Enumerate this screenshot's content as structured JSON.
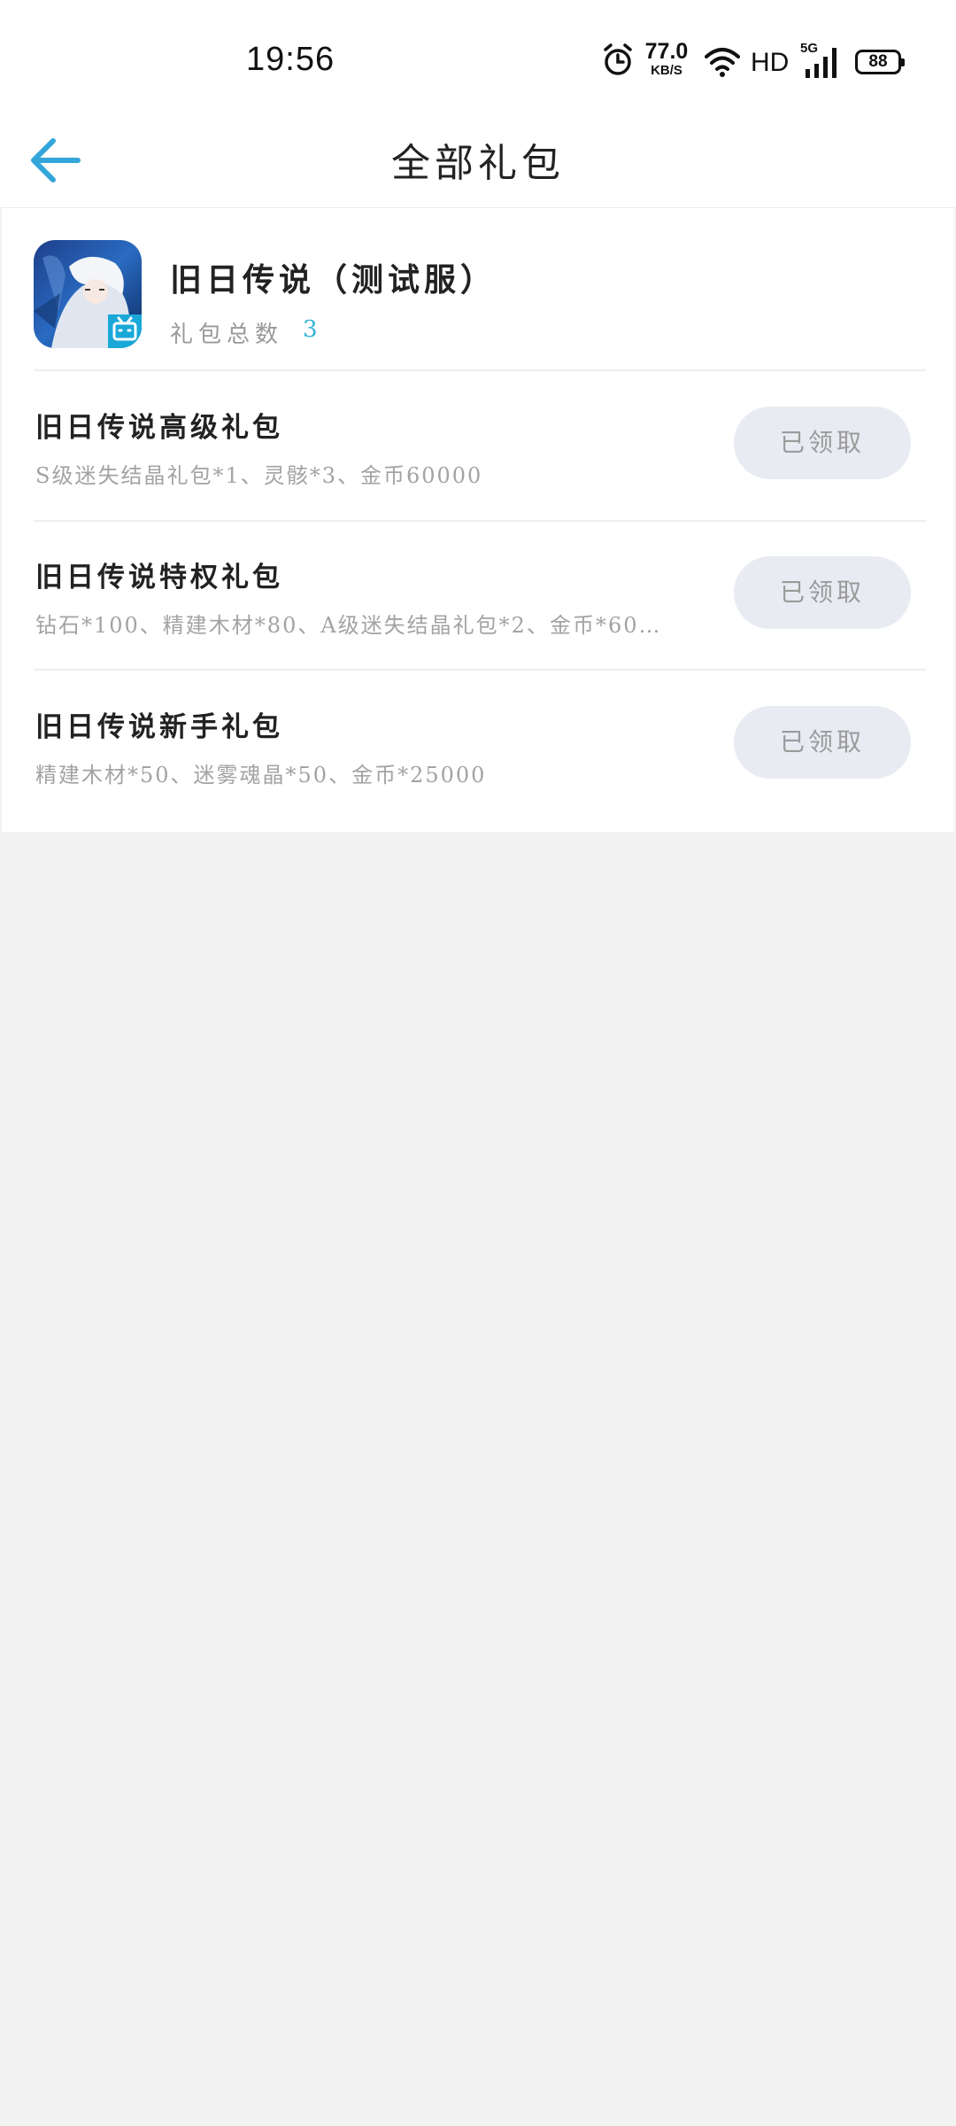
{
  "status_bar": {
    "time": "19:56",
    "net_speed_value": "77.0",
    "net_speed_unit": "KB/S",
    "network_label": "HD",
    "signal_label": "5G",
    "battery": "88",
    "icons": [
      "alarm-icon",
      "wifi-icon",
      "signal-icon",
      "battery-icon"
    ]
  },
  "header": {
    "title": "全部礼包",
    "back_icon": "arrow-left-icon",
    "accent_color": "#33a6d9"
  },
  "game": {
    "name": "旧日传说（测试服）",
    "gift_total_label": "礼包总数",
    "gift_total_count": "3",
    "count_color": "#33b4d6"
  },
  "gifts": [
    {
      "title": "旧日传说高级礼包",
      "desc": "S级迷失结晶礼包*1、灵骸*3、金币60000",
      "button": "已领取"
    },
    {
      "title": "旧日传说特权礼包",
      "desc": "钻石*100、精建木材*80、A级迷失结晶礼包*2、金币*60…",
      "button": "已领取"
    },
    {
      "title": "旧日传说新手礼包",
      "desc": "精建木材*50、迷雾魂晶*50、金币*25000",
      "button": "已领取"
    }
  ]
}
